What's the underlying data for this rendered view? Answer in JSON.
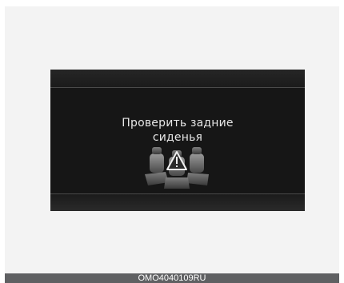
{
  "display": {
    "message_line1": "Проверить задние",
    "message_line2": "сиденья",
    "icon": "rear-seats-warning-icon"
  },
  "caption": {
    "code": "OMO4040109RU"
  },
  "colors": {
    "display_bg": "#161616",
    "text": "#e6e6e6",
    "caption_bar": "#5f6062",
    "panel_bg": "#f3f3f3"
  }
}
